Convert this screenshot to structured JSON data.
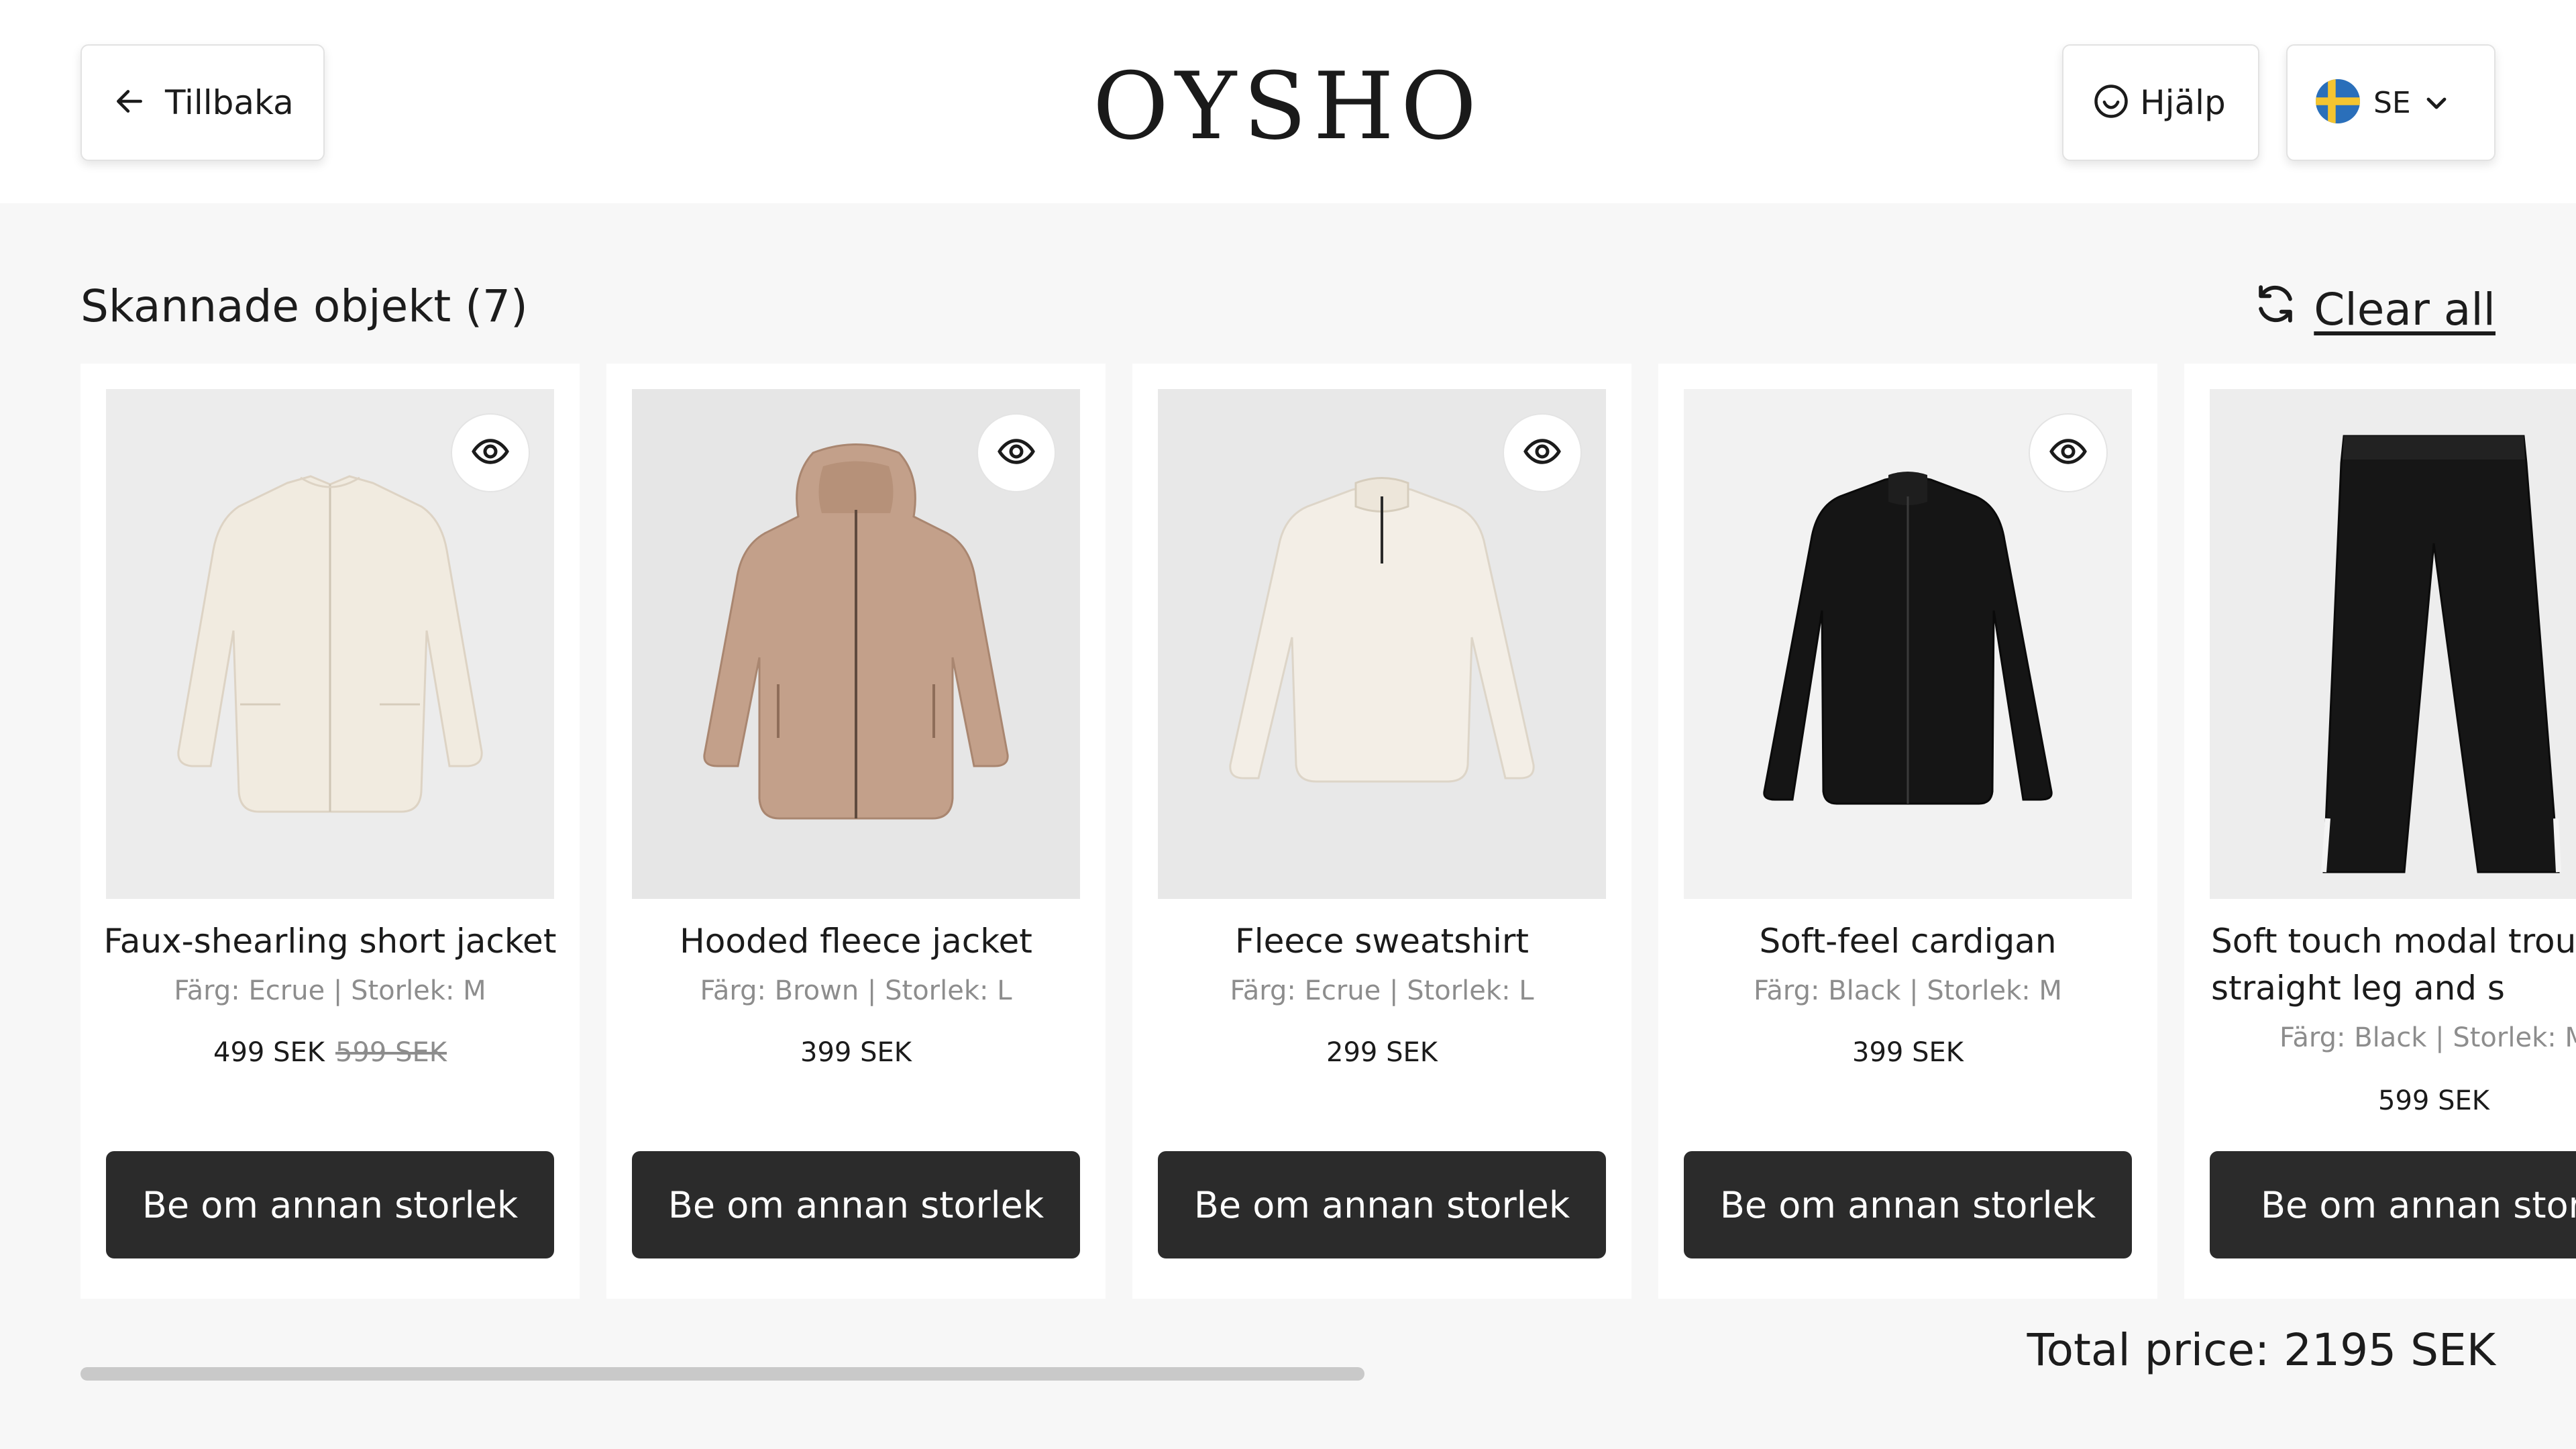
{
  "header": {
    "back_label": "Tillbaka",
    "logo": "OYSHO",
    "help_label": "Hjälp",
    "lang_code": "SE"
  },
  "section": {
    "title": "Skannade objekt (7)",
    "clear_all_label": "Clear all"
  },
  "products": [
    {
      "name": "Faux-shearling short jacket",
      "meta": "Färg: Ecrue | Storlek: M",
      "price": "499 SEK",
      "old_price": "599 SEK",
      "cta": "Be om annan storlek"
    },
    {
      "name": "Hooded fleece jacket",
      "meta": "Färg: Brown | Storlek: L",
      "price": "399 SEK",
      "cta": "Be om annan storlek"
    },
    {
      "name": "Fleece sweatshirt",
      "meta": "Färg: Ecrue | Storlek: L",
      "price": "299 SEK",
      "cta": "Be om annan storlek"
    },
    {
      "name": "Soft-feel cardigan",
      "meta": "Färg: Black | Storlek: M",
      "price": "399 SEK",
      "cta": "Be om annan storlek"
    },
    {
      "name": "Soft touch modal trou with straight leg and s",
      "meta": "Färg: Black | Storlek: M",
      "price": "599 SEK",
      "cta": "Be om annan storlek"
    }
  ],
  "footer": {
    "total_label": "Total price: 2195 SEK"
  },
  "colors": {
    "accent_dark": "#2b2b2b",
    "muted_text": "#8d8d8d",
    "background": "#f7f7f7"
  },
  "icons": [
    "arrow-left-icon",
    "smiley-icon",
    "sweden-flag-icon",
    "chevron-down-icon",
    "refresh-icon",
    "eye-icon"
  ]
}
